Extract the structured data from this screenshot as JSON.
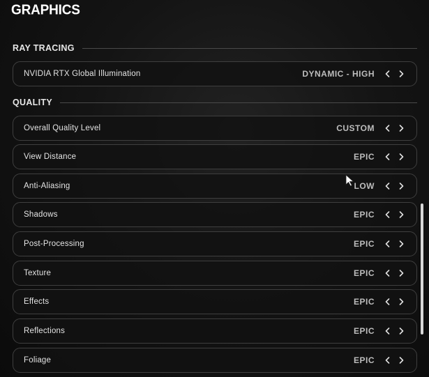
{
  "page": {
    "title": "GRAPHICS"
  },
  "sections": {
    "ray_tracing": {
      "label": "RAY TRACING",
      "rows": [
        {
          "name": "NVIDIA RTX Global Illumination",
          "value": "DYNAMIC - HIGH"
        }
      ]
    },
    "quality": {
      "label": "QUALITY",
      "rows": [
        {
          "name": "Overall Quality Level",
          "value": "CUSTOM"
        },
        {
          "name": "View Distance",
          "value": "EPIC"
        },
        {
          "name": "Anti-Aliasing",
          "value": "LOW"
        },
        {
          "name": "Shadows",
          "value": "EPIC"
        },
        {
          "name": "Post-Processing",
          "value": "EPIC"
        },
        {
          "name": "Texture",
          "value": "EPIC"
        },
        {
          "name": "Effects",
          "value": "EPIC"
        },
        {
          "name": "Reflections",
          "value": "EPIC"
        },
        {
          "name": "Foliage",
          "value": "EPIC"
        }
      ]
    }
  },
  "icons": {
    "prev": "chevron-left-icon",
    "next": "chevron-right-icon",
    "cursor": "mouse-pointer-icon"
  },
  "colors": {
    "accent_text": "#ffffff",
    "value_text": "#bdbdbd",
    "border": "#3f3f3f"
  }
}
